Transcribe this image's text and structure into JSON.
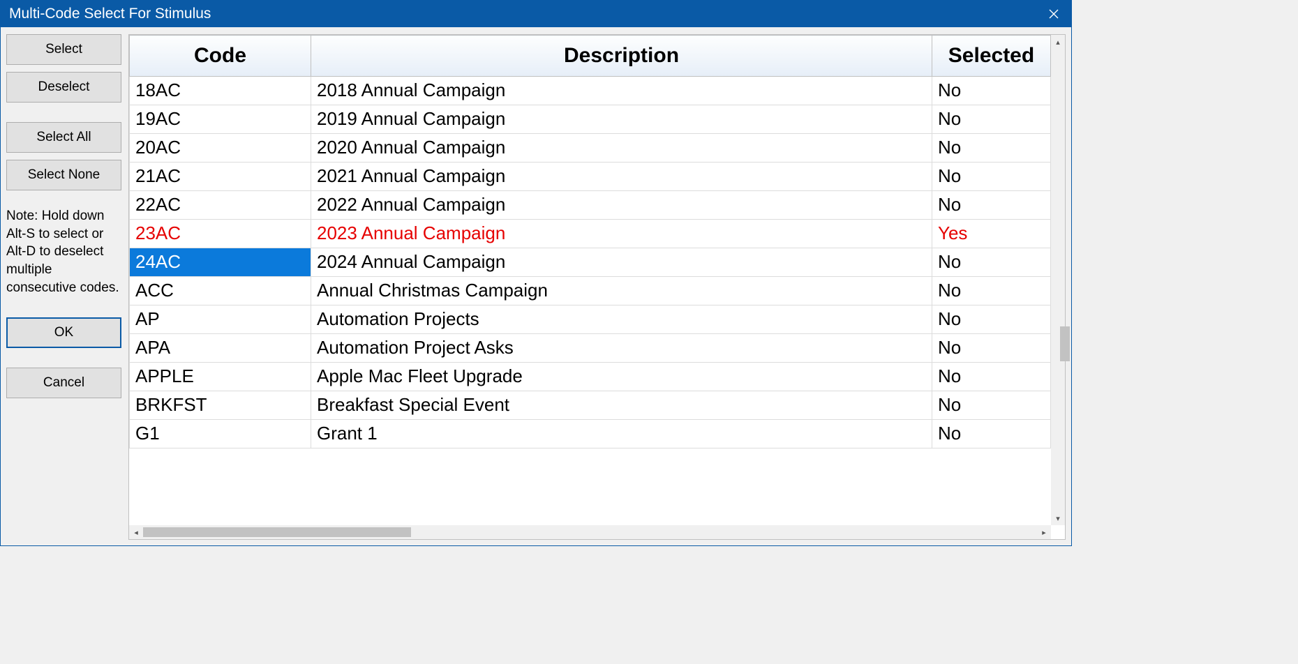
{
  "window": {
    "title": "Multi-Code Select For Stimulus"
  },
  "sidebar": {
    "select": "Select",
    "deselect": "Deselect",
    "select_all": "Select All",
    "select_none": "Select None",
    "note": "Note: Hold down Alt-S to select or Alt-D to deselect multiple consecutive codes.",
    "ok": "OK",
    "cancel": "Cancel"
  },
  "table": {
    "headers": {
      "code": "Code",
      "description": "Description",
      "selected": "Selected"
    },
    "rows": [
      {
        "code": "18AC",
        "description": "2018 Annual Campaign",
        "selected": "No",
        "is_selected": false,
        "highlight_code": false
      },
      {
        "code": "19AC",
        "description": "2019 Annual Campaign",
        "selected": "No",
        "is_selected": false,
        "highlight_code": false
      },
      {
        "code": "20AC",
        "description": "2020 Annual Campaign",
        "selected": "No",
        "is_selected": false,
        "highlight_code": false
      },
      {
        "code": "21AC",
        "description": "2021 Annual Campaign",
        "selected": "No",
        "is_selected": false,
        "highlight_code": false
      },
      {
        "code": "22AC",
        "description": "2022 Annual Campaign",
        "selected": "No",
        "is_selected": false,
        "highlight_code": false
      },
      {
        "code": "23AC",
        "description": "2023 Annual Campaign",
        "selected": "Yes",
        "is_selected": true,
        "highlight_code": false
      },
      {
        "code": "24AC",
        "description": "2024 Annual Campaign",
        "selected": "No",
        "is_selected": false,
        "highlight_code": true
      },
      {
        "code": "ACC",
        "description": "Annual Christmas Campaign",
        "selected": "No",
        "is_selected": false,
        "highlight_code": false
      },
      {
        "code": "AP",
        "description": "Automation Projects",
        "selected": "No",
        "is_selected": false,
        "highlight_code": false
      },
      {
        "code": "APA",
        "description": "Automation Project Asks",
        "selected": "No",
        "is_selected": false,
        "highlight_code": false
      },
      {
        "code": "APPLE",
        "description": "Apple Mac Fleet Upgrade",
        "selected": "No",
        "is_selected": false,
        "highlight_code": false
      },
      {
        "code": "BRKFST",
        "description": "Breakfast Special Event",
        "selected": "No",
        "is_selected": false,
        "highlight_code": false
      },
      {
        "code": "G1",
        "description": "Grant 1",
        "selected": "No",
        "is_selected": false,
        "highlight_code": false
      }
    ]
  }
}
